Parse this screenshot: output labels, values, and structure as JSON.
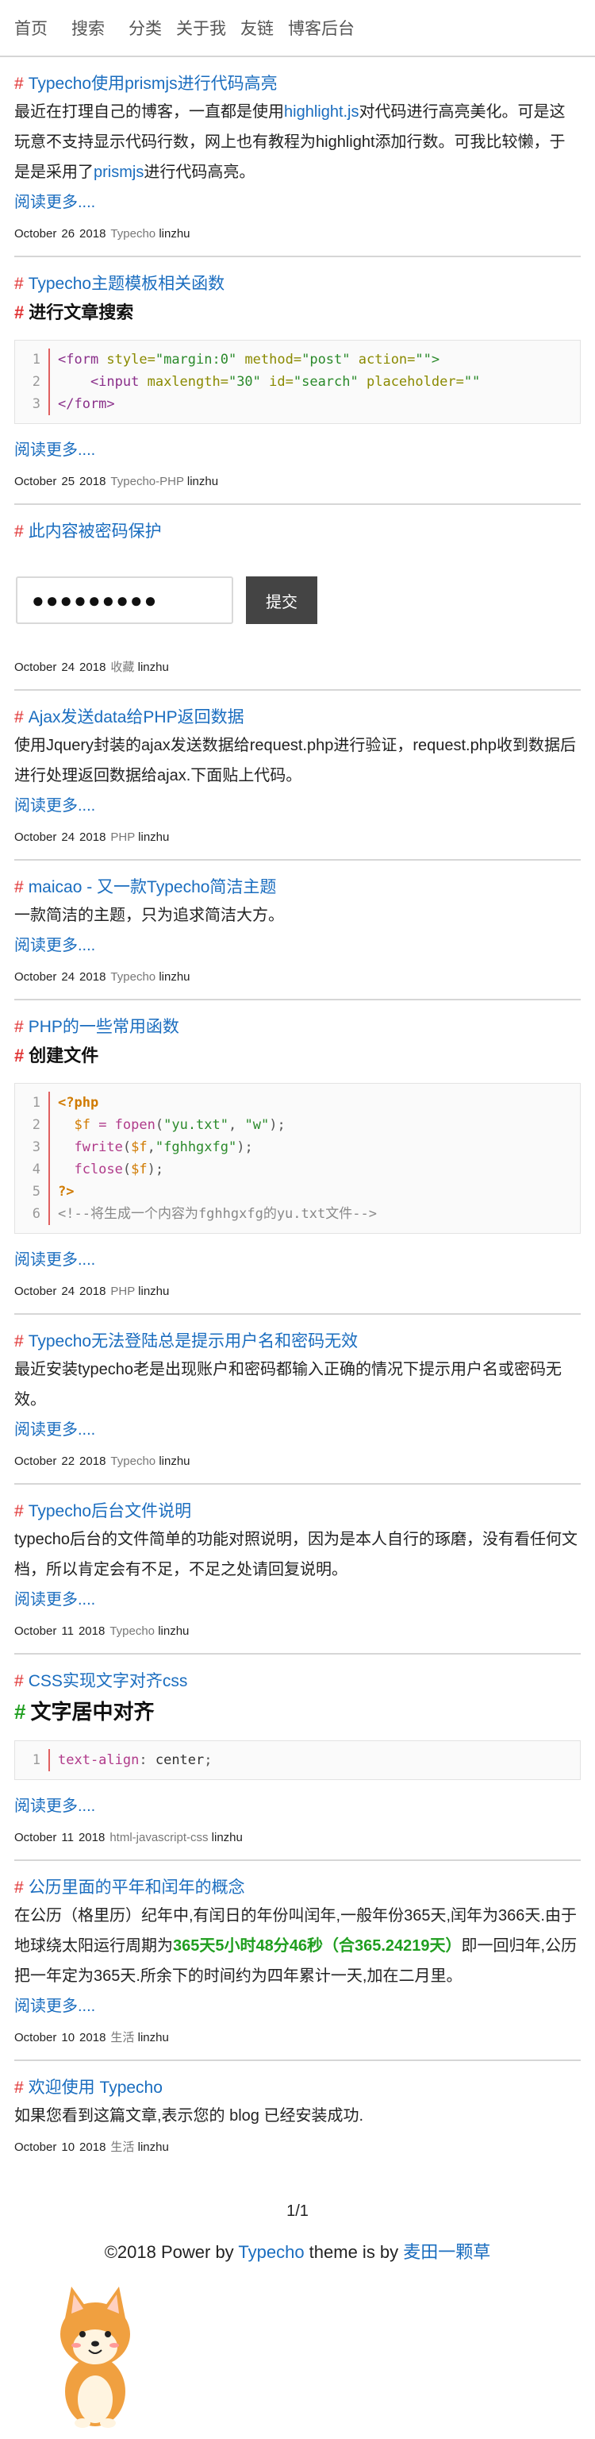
{
  "nav": {
    "items": [
      "首页",
      "搜索",
      "分类",
      "关于我",
      "友链",
      "博客后台"
    ]
  },
  "posts": [
    {
      "title": "Typecho使用prismjs进行代码高亮",
      "excerpt": [
        "最近在打理自己的博客，一直都是使用",
        "highlight.js",
        "对代码进行高亮美化。可是这玩意不支持显示代码行数，网上也有教程为highlight添加行数。可我比较懒，于是是采用了",
        "prismjs",
        "进行代码高亮。"
      ],
      "read_more": "阅读更多....",
      "meta": {
        "month": "October",
        "day": "26",
        "year": "2018",
        "category": "Typecho",
        "author": "linzhu"
      }
    },
    {
      "title": "Typecho主题模板相关函数",
      "subheading": "进行文章搜索",
      "code": {
        "line_numbers": [
          "1",
          "2",
          "3"
        ],
        "lines": [
          [
            "<form ",
            "style=",
            "\"margin:0\" ",
            "method=",
            "\"post\" ",
            "action=",
            "\"\">"
          ],
          [
            "    <input ",
            "maxlength=",
            "\"30\" ",
            "id=",
            "\"search\" ",
            "placeholder=",
            "\"\""
          ],
          [
            "</form>"
          ]
        ]
      },
      "read_more": "阅读更多....",
      "meta": {
        "month": "October",
        "day": "25",
        "year": "2018",
        "category": "Typecho-PHP",
        "author": "linzhu"
      }
    },
    {
      "title": "此内容被密码保护",
      "password_value": "●●●●●●●●●",
      "submit_label": "提交",
      "meta": {
        "month": "October",
        "day": "24",
        "year": "2018",
        "category": "收藏",
        "author": "linzhu"
      }
    },
    {
      "title": "Ajax发送data给PHP返回数据",
      "excerpt": "使用Jquery封装的ajax发送数据给request.php进行验证，request.php收到数据后进行处理返回数据给ajax.下面贴上代码。",
      "read_more": "阅读更多....",
      "meta": {
        "month": "October",
        "day": "24",
        "year": "2018",
        "category": "PHP",
        "author": "linzhu"
      }
    },
    {
      "title": "maicao - 又一款Typecho简洁主题",
      "excerpt": "一款简洁的主题，只为追求简洁大方。",
      "read_more": "阅读更多....",
      "meta": {
        "month": "October",
        "day": "24",
        "year": "2018",
        "category": "Typecho",
        "author": "linzhu"
      }
    },
    {
      "title": "PHP的一些常用函数",
      "subheading": "创建文件",
      "code": {
        "line_numbers": [
          "1",
          "2",
          "3",
          "4",
          "5",
          "6"
        ],
        "lines": [
          [
            "<?php"
          ],
          [
            "  $f",
            " = ",
            "fopen",
            "(",
            "\"yu.txt\"",
            ", ",
            "\"w\"",
            ");"
          ],
          [
            "  fwrite",
            "(",
            "$f",
            ",",
            "\"fghhgxfg\"",
            ");"
          ],
          [
            "  fclose",
            "(",
            "$f",
            ");"
          ],
          [
            "?>"
          ],
          [
            "<!--将生成一个内容为fghhgxfg的yu.txt文件-->"
          ]
        ]
      },
      "read_more": "阅读更多....",
      "meta": {
        "month": "October",
        "day": "24",
        "year": "2018",
        "category": "PHP",
        "author": "linzhu"
      }
    },
    {
      "title": "Typecho无法登陆总是提示用户名和密码无效",
      "excerpt": "最近安装typecho老是出现账户和密码都输入正确的情况下提示用户名或密码无效。",
      "read_more": "阅读更多....",
      "meta": {
        "month": "October",
        "day": "22",
        "year": "2018",
        "category": "Typecho",
        "author": "linzhu"
      }
    },
    {
      "title": "Typecho后台文件说明",
      "excerpt": "typecho后台的文件简单的功能对照说明，因为是本人自行的琢磨，没有看任何文档，所以肯定会有不足，不足之处请回复说明。",
      "read_more": "阅读更多....",
      "meta": {
        "month": "October",
        "day": "11",
        "year": "2018",
        "category": "Typecho",
        "author": "linzhu"
      }
    },
    {
      "title": "CSS实现文字对齐css",
      "subheading": "文字居中对齐",
      "code": {
        "line_numbers": [
          "1"
        ],
        "lines": [
          [
            "text-align",
            ": ",
            "center",
            ";"
          ]
        ]
      },
      "read_more": "阅读更多....",
      "meta": {
        "month": "October",
        "day": "11",
        "year": "2018",
        "category": "html-javascript-css",
        "author": "linzhu"
      }
    },
    {
      "title": "公历里面的平年和闰年的概念",
      "excerpt": [
        "在公历（格里历）纪年中,有闰日的年份叫闰年,一般年份365天,闰年为366天.由于地球绕太阳运行周期为",
        "365天5小时48分46秒（合365.24219天）",
        "即一回归年,公历把一年定为365天.所余下的时间约为四年累计一天,加在二月里。"
      ],
      "read_more": "阅读更多....",
      "meta": {
        "month": "October",
        "day": "10",
        "year": "2018",
        "category": "生活",
        "author": "linzhu"
      }
    },
    {
      "title": "欢迎使用 Typecho",
      "excerpt": "如果您看到这篇文章,表示您的 blog 已经安装成功.",
      "meta": {
        "month": "October",
        "day": "10",
        "year": "2018",
        "category": "生活",
        "author": "linzhu"
      }
    }
  ],
  "pager": {
    "text": "1/1"
  },
  "footer": {
    "prefix": "©2018 Power by ",
    "typecho": "Typecho",
    "middle": " theme is by ",
    "author": "麦田一颗草"
  },
  "colors": {
    "link": "#1a6dbf",
    "hash": "#e03030",
    "highlight_green": "#1f9e1f"
  }
}
